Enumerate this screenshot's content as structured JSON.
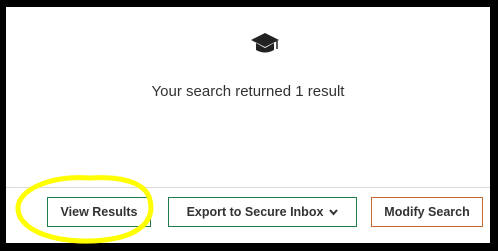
{
  "results": {
    "icon": "graduation-cap-icon",
    "summary_text": "Your search returned 1 result"
  },
  "actions": {
    "view_results_label": "View Results",
    "export_label": "Export to Secure Inbox",
    "export_icon": "chevron-down-icon",
    "modify_label": "Modify Search"
  },
  "colors": {
    "panel_background": "#ffffff",
    "frame": "#000000",
    "green_border": "#1e7b4a",
    "orange_border": "#c8672f",
    "highlight": "#ffff00"
  }
}
